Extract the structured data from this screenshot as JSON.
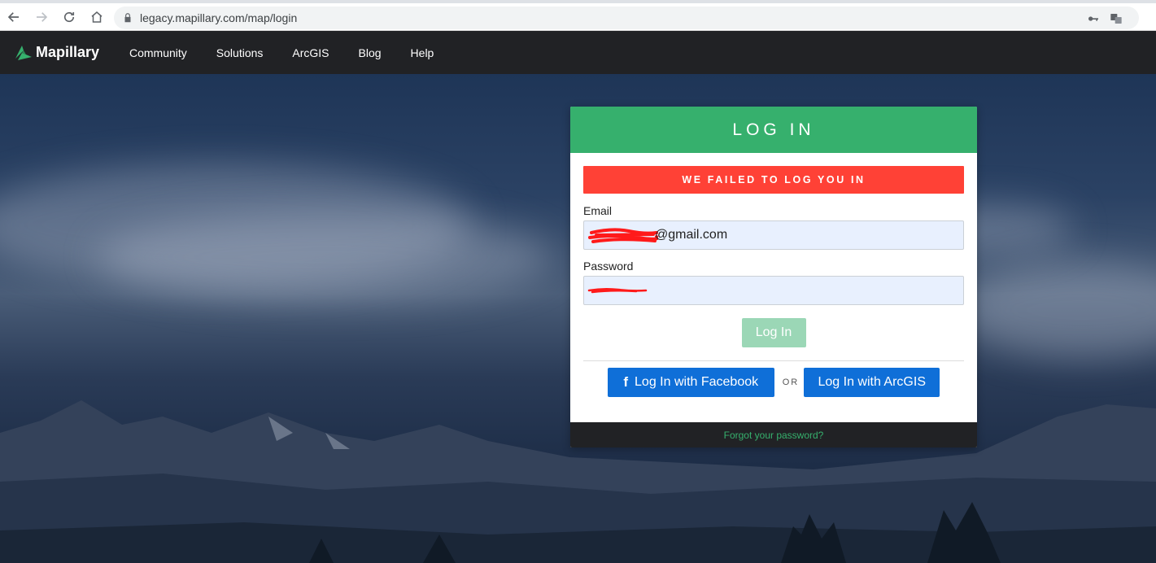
{
  "browser": {
    "url": "legacy.mapillary.com/map/login"
  },
  "nav": {
    "brand": "Mapillary",
    "links": [
      "Community",
      "Solutions",
      "ArcGIS",
      "Blog",
      "Help"
    ]
  },
  "login": {
    "title": "LOG IN",
    "error": "WE FAILED TO LOG YOU IN",
    "email_label": "Email",
    "email_value": "@gmail.com",
    "password_label": "Password",
    "submit_label": "Log In",
    "facebook_label": "Log In with Facebook",
    "or_label": "OR",
    "arcgis_label": "Log In with ArcGIS",
    "forgot_label": "Forgot your password?"
  },
  "colors": {
    "brand_green": "#36b06d",
    "error_red": "#ff4136",
    "social_blue": "#0f6fd8",
    "nav_dark": "#212225"
  }
}
